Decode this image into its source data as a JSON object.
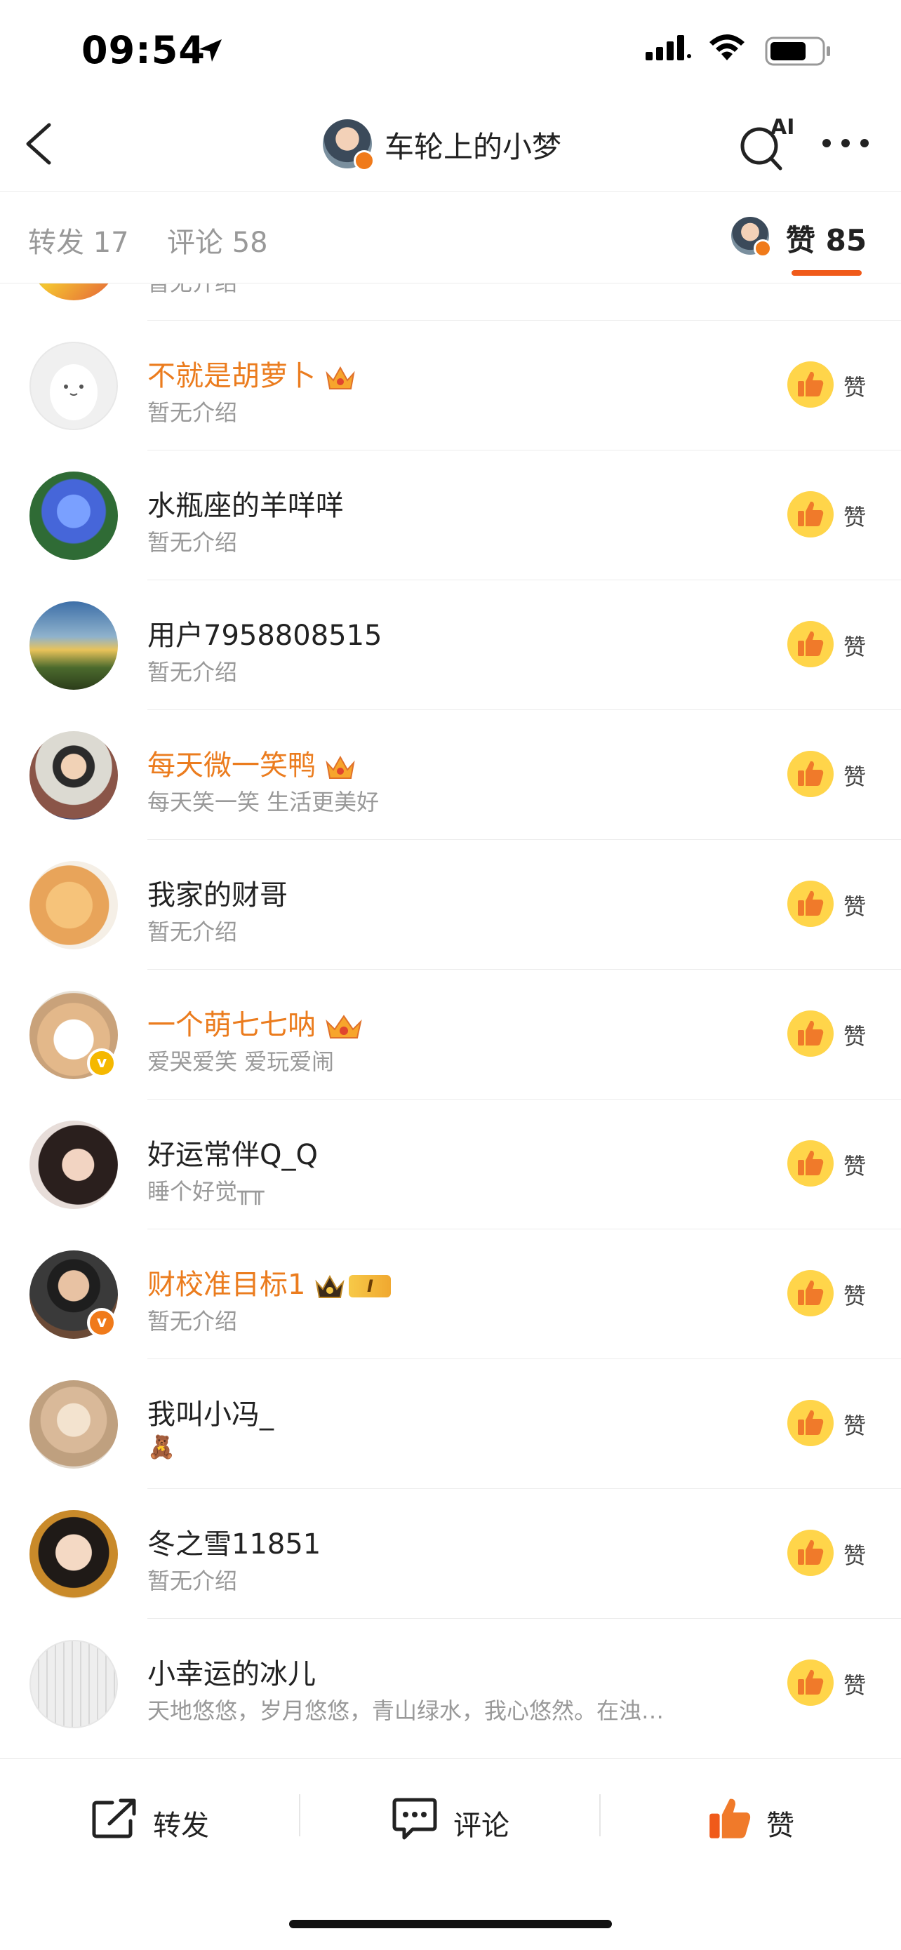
{
  "status_bar": {
    "time": "09:54"
  },
  "header": {
    "title": "车轮上的小梦",
    "ai_label": "AI"
  },
  "tabs": {
    "repost": "转发 17",
    "comment": "评论 58",
    "like": "赞 85"
  },
  "partial_row": {
    "bio": "暂无介绍"
  },
  "likers": [
    {
      "name": "不就是胡萝卜",
      "bio": "暂无介绍",
      "vip": true,
      "like_label": "赞"
    },
    {
      "name": "水瓶座的羊咩咩",
      "bio": "暂无介绍",
      "vip": false,
      "like_label": "赞"
    },
    {
      "name": "用户7958808515",
      "bio": "暂无介绍",
      "vip": false,
      "like_label": "赞"
    },
    {
      "name": "每天微一笑鸭",
      "bio": "每天笑一笑 生活更美好",
      "vip": true,
      "like_label": "赞"
    },
    {
      "name": "我家的财哥",
      "bio": "暂无介绍",
      "vip": false,
      "like_label": "赞"
    },
    {
      "name": "一个萌七七呐",
      "bio": "爱哭爱笑 爱玩爱闹",
      "vip": true,
      "like_label": "赞"
    },
    {
      "name": "好运常伴Q_Q",
      "bio": "睡个好觉╥╥",
      "vip": false,
      "like_label": "赞"
    },
    {
      "name": "财校准目标1",
      "bio": "暂无介绍",
      "vip": true,
      "vip_level": "I",
      "like_label": "赞"
    },
    {
      "name": "我叫小冯_",
      "bio": "🧸",
      "vip": false,
      "like_label": "赞"
    },
    {
      "name": "冬之雪11851",
      "bio": "暂无介绍",
      "vip": false,
      "like_label": "赞"
    },
    {
      "name": "小幸运的冰儿",
      "bio": "天地悠悠，岁月悠悠，青山绿水，我心悠然。在浊…",
      "vip": false,
      "like_label": "赞"
    }
  ],
  "bottom_bar": {
    "repost": "转发",
    "comment": "评论",
    "like": "赞"
  },
  "colors": {
    "accent": "#f05a1a",
    "vip_name": "#eb7c1e",
    "like_bg": "#ffd54a"
  }
}
